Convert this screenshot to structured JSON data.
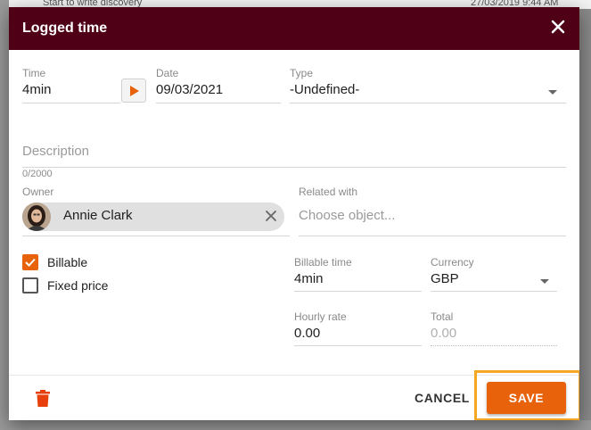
{
  "background": {
    "top_text": "Start to write discovery",
    "top_date": "27/03/2019 9:44 AM"
  },
  "dialog": {
    "title": "Logged time",
    "close_icon": "close-icon",
    "header_color": "#4f0017"
  },
  "form": {
    "time": {
      "label": "Time",
      "value": "4min"
    },
    "date": {
      "label": "Date",
      "value": "09/03/2021"
    },
    "type": {
      "label": "Type",
      "value": "-Undefined-"
    },
    "description": {
      "placeholder": "Description",
      "counter": "0/2000"
    },
    "owner": {
      "label": "Owner",
      "name": "Annie Clark"
    },
    "related": {
      "label": "Related with",
      "placeholder": "Choose object..."
    },
    "billable": {
      "label": "Billable",
      "checked": true
    },
    "fixed_price": {
      "label": "Fixed price",
      "checked": false
    },
    "billable_time": {
      "label": "Billable time",
      "value": "4min"
    },
    "currency": {
      "label": "Currency",
      "value": "GBP"
    },
    "hourly_rate": {
      "label": "Hourly rate",
      "value": "0.00"
    },
    "total": {
      "label": "Total",
      "value": "0.00"
    }
  },
  "footer": {
    "cancel_label": "CANCEL",
    "save_label": "SAVE",
    "accent_color": "#e8620c"
  }
}
